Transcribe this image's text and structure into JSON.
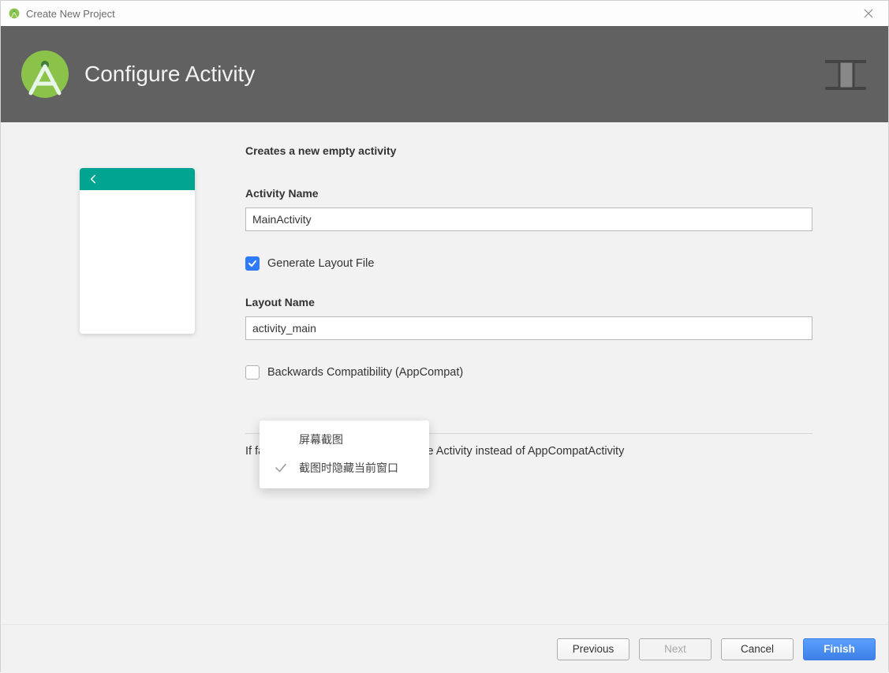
{
  "window": {
    "title": "Create New Project"
  },
  "header": {
    "title": "Configure Activity"
  },
  "form": {
    "description": "Creates a new empty activity",
    "activity": {
      "label": "Activity Name",
      "value": "MainActivity"
    },
    "generate_layout": {
      "label": "Generate Layout File",
      "checked": true
    },
    "layout": {
      "label": "Layout Name",
      "value": "activity_main"
    },
    "backcompat": {
      "label": "Backwards Compatibility (AppCompat)",
      "checked": false
    },
    "hint": "If false, this activity base class will be Activity instead of AppCompatActivity"
  },
  "popup": {
    "title": "屏幕截图",
    "item": "截图时隐藏当前窗口"
  },
  "footer": {
    "previous": "Previous",
    "next": "Next",
    "cancel": "Cancel",
    "finish": "Finish"
  }
}
